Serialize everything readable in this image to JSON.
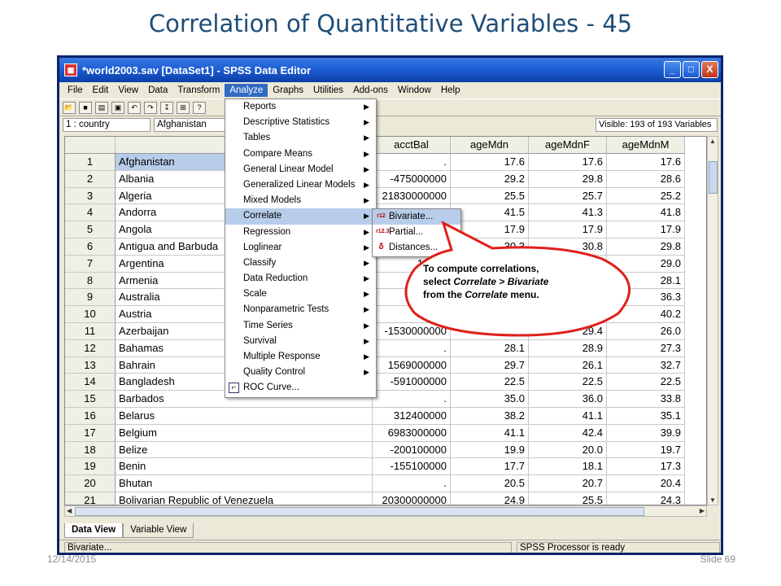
{
  "slide": {
    "title": "Correlation of Quantitative Variables - 45",
    "date": "12/14/2015",
    "slide_number": "Slide 69"
  },
  "window": {
    "title": "*world2003.sav [DataSet1] - SPSS Data Editor",
    "controls": [
      "_",
      "□",
      "X"
    ]
  },
  "menubar": [
    "File",
    "Edit",
    "View",
    "Data",
    "Transform",
    "Analyze",
    "Graphs",
    "Utilities",
    "Add-ons",
    "Window",
    "Help"
  ],
  "active_menu": "Analyze",
  "cellbar": {
    "cell_ref": "1 : country",
    "cell_value": "Afghanistan",
    "visible": "Visible: 193 of 193 Variables"
  },
  "grid": {
    "columns": [
      "acctBal",
      "ageMdn",
      "ageMdnF",
      "ageMdnM"
    ],
    "rows": [
      {
        "n": "1",
        "country": "Afghanistan",
        "acctBal": ".",
        "ageMdn": "17.6",
        "ageMdnF": "17.6",
        "ageMdnM": "17.6"
      },
      {
        "n": "2",
        "country": "Albania",
        "acctBal": "-475000000",
        "ageMdn": "29.2",
        "ageMdnF": "29.8",
        "ageMdnM": "28.6"
      },
      {
        "n": "3",
        "country": "Algeria",
        "acctBal": "21830000000",
        "ageMdn": "25.5",
        "ageMdnF": "25.7",
        "ageMdnM": "25.2"
      },
      {
        "n": "4",
        "country": "Andorra",
        "acctBal": "",
        "ageMdn": "41.5",
        "ageMdnF": "41.3",
        "ageMdnM": "41.8"
      },
      {
        "n": "5",
        "country": "Angola",
        "acctBal": "",
        "ageMdn": "17.9",
        "ageMdnF": "17.9",
        "ageMdnM": "17.9"
      },
      {
        "n": "6",
        "country": "Antigua and Barbuda",
        "acctBal": "",
        "ageMdn": "30.3",
        "ageMdnF": "30.8",
        "ageMdnM": "29.8"
      },
      {
        "n": "7",
        "country": "Argentina",
        "acctBal": "19080",
        "ageMdn": "",
        "ageMdnF": "",
        "ageMdnM": "29.0"
      },
      {
        "n": "8",
        "country": "Armenia",
        "acctBal": "-2",
        "ageMdn": "",
        "ageMdnF": "",
        "ageMdnM": "28.1"
      },
      {
        "n": "9",
        "country": "Australia",
        "acctBal": "-411",
        "ageMdn": "",
        "ageMdnF": "",
        "ageMdnM": "36.3"
      },
      {
        "n": "10",
        "country": "Austria",
        "acctBal": "17550",
        "ageMdn": "",
        "ageMdnF": "2.4",
        "ageMdnM": "40.2"
      },
      {
        "n": "11",
        "country": "Azerbaijan",
        "acctBal": "-1530000000",
        "ageMdn": "27.6",
        "ageMdnF": "29.4",
        "ageMdnM": "26.0"
      },
      {
        "n": "12",
        "country": "Bahamas",
        "acctBal": ".",
        "ageMdn": "28.1",
        "ageMdnF": "28.9",
        "ageMdnM": "27.3"
      },
      {
        "n": "13",
        "country": "Bahrain",
        "acctBal": "1569000000",
        "ageMdn": "29.7",
        "ageMdnF": "26.1",
        "ageMdnM": "32.7"
      },
      {
        "n": "14",
        "country": "Bangladesh",
        "acctBal": "-591000000",
        "ageMdn": "22.5",
        "ageMdnF": "22.5",
        "ageMdnM": "22.5"
      },
      {
        "n": "15",
        "country": "Barbados",
        "acctBal": ".",
        "ageMdn": "35.0",
        "ageMdnF": "36.0",
        "ageMdnM": "33.8"
      },
      {
        "n": "16",
        "country": "Belarus",
        "acctBal": "312400000",
        "ageMdn": "38.2",
        "ageMdnF": "41.1",
        "ageMdnM": "35.1"
      },
      {
        "n": "17",
        "country": "Belgium",
        "acctBal": "6983000000",
        "ageMdn": "41.1",
        "ageMdnF": "42.4",
        "ageMdnM": "39.9"
      },
      {
        "n": "18",
        "country": "Belize",
        "acctBal": "-200100000",
        "ageMdn": "19.9",
        "ageMdnF": "20.0",
        "ageMdnM": "19.7"
      },
      {
        "n": "19",
        "country": "Benin",
        "acctBal": "-155100000",
        "ageMdn": "17.7",
        "ageMdnF": "18.1",
        "ageMdnM": "17.3"
      },
      {
        "n": "20",
        "country": "Bhutan",
        "acctBal": ".",
        "ageMdn": "20.5",
        "ageMdnF": "20.7",
        "ageMdnM": "20.4"
      },
      {
        "n": "21",
        "country": "Bolivarian Republic of Venezuela",
        "acctBal": "20300000000",
        "ageMdn": "24.9",
        "ageMdnF": "25.5",
        "ageMdnM": "24.3"
      }
    ]
  },
  "analyze_menu": [
    {
      "label": "Reports",
      "arrow": "▶"
    },
    {
      "label": "Descriptive Statistics",
      "arrow": "▶"
    },
    {
      "label": "Tables",
      "arrow": "▶"
    },
    {
      "label": "Compare Means",
      "arrow": "▶"
    },
    {
      "label": "General Linear Model",
      "arrow": "▶"
    },
    {
      "label": "Generalized Linear Models",
      "arrow": "▶"
    },
    {
      "label": "Mixed Models",
      "arrow": "▶"
    },
    {
      "label": "Correlate",
      "arrow": "▶"
    },
    {
      "label": "Regression",
      "arrow": "▶"
    },
    {
      "label": "Loglinear",
      "arrow": "▶"
    },
    {
      "label": "Classify",
      "arrow": "▶"
    },
    {
      "label": "Data Reduction",
      "arrow": "▶"
    },
    {
      "label": "Scale",
      "arrow": "▶"
    },
    {
      "label": "Nonparametric Tests",
      "arrow": "▶"
    },
    {
      "label": "Time Series",
      "arrow": "▶"
    },
    {
      "label": "Survival",
      "arrow": "▶"
    },
    {
      "label": "Multiple Response",
      "arrow": "▶"
    },
    {
      "label": "Quality Control",
      "arrow": "▶"
    },
    {
      "label": "ROC Curve...",
      "arrow": ""
    }
  ],
  "correlate_menu": [
    {
      "label": "Bivariate...",
      "icon": "r12"
    },
    {
      "label": "Partial...",
      "icon": "r12.3"
    },
    {
      "label": "Distances...",
      "icon": "δ"
    }
  ],
  "callout": {
    "line1": "To compute correlations,",
    "line2_prefix": "select ",
    "line2_em": "Correlate > Bivariate",
    "line3_prefix": "from the ",
    "line3_em": "Correlate",
    "line3_suffix": " menu."
  },
  "tabs": [
    "Data View",
    "Variable View"
  ],
  "status": {
    "left": "Bivariate...",
    "right": "SPSS  Processor is ready"
  },
  "colors": {
    "title": "#1f4e79",
    "titlebar": "#1e5fd6",
    "callout_fill": "#ffffff",
    "callout_stroke": "#e0201b",
    "highlight": "#b7cdea"
  }
}
